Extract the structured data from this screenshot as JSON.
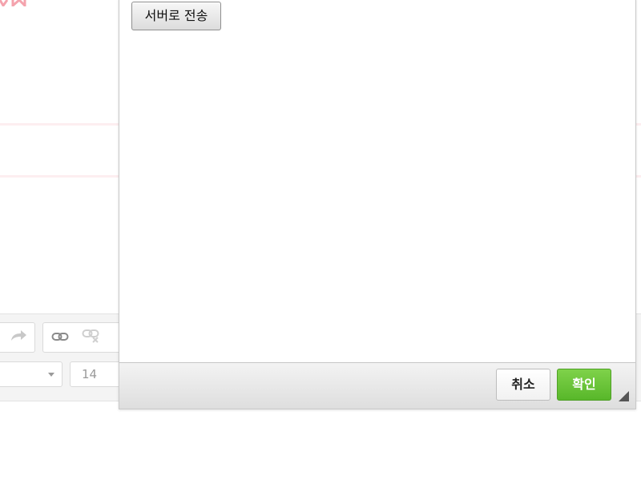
{
  "dialog": {
    "upload_button_label": "서버로 전송",
    "cancel_label": "취소",
    "confirm_label": "확인"
  },
  "editor_toolbar": {
    "font_size_value": "14",
    "icons": [
      "redo-icon",
      "link-icon",
      "unlink-icon"
    ],
    "font_family_value": ""
  },
  "colors": {
    "confirm_green": "#67c23a",
    "background_rule_pink": "#fdeef0",
    "logo_pink": "#f4a3ad"
  }
}
